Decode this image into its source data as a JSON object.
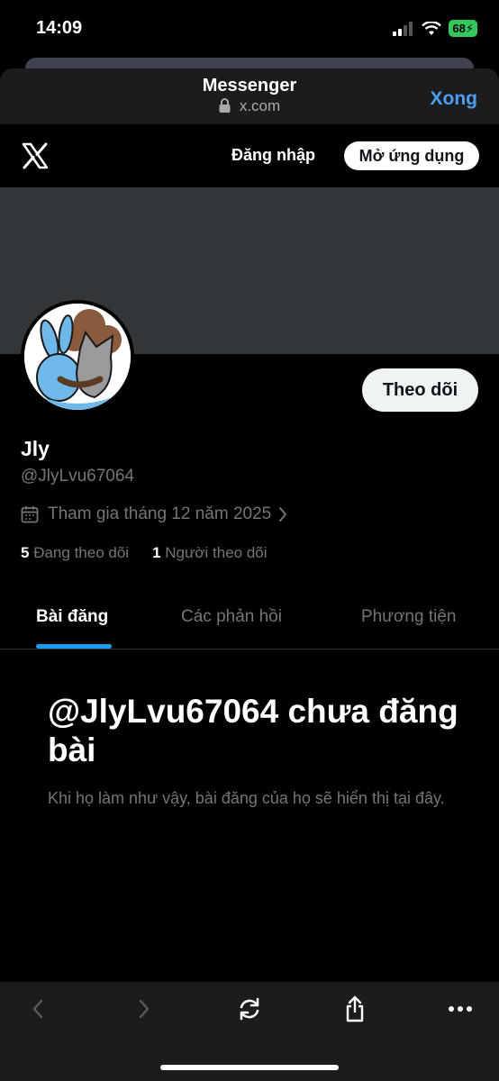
{
  "status": {
    "time": "14:09",
    "battery": "68"
  },
  "browser": {
    "title": "Messenger",
    "url": "x.com",
    "done_label": "Xong"
  },
  "x_header": {
    "login_label": "Đăng nhập",
    "open_app_label": "Mở ứng dụng"
  },
  "profile": {
    "display_name": "Jly",
    "handle": "@JlyLvu67064",
    "joined": "Tham gia tháng 12 năm 2025",
    "following_count": "5",
    "following_label": "Đang theo dõi",
    "followers_count": "1",
    "followers_label": "Người theo dõi",
    "follow_button": "Theo dõi"
  },
  "tabs": [
    "Bài đăng",
    "Các phản hồi",
    "Phương tiện"
  ],
  "empty_state": {
    "title": "@JlyLvu67064 chưa đăng bài",
    "subtitle": "Khi họ làm như vậy, bài đăng của họ sẽ hiển thị tại đây."
  },
  "colors": {
    "accent": "#1d9bf0",
    "link": "#4a9ff5",
    "banner": "#333639"
  },
  "icons": [
    "back-icon",
    "forward-icon",
    "reload-icon",
    "share-icon",
    "more-icon",
    "lock-icon",
    "calendar-icon",
    "x-logo-icon"
  ]
}
